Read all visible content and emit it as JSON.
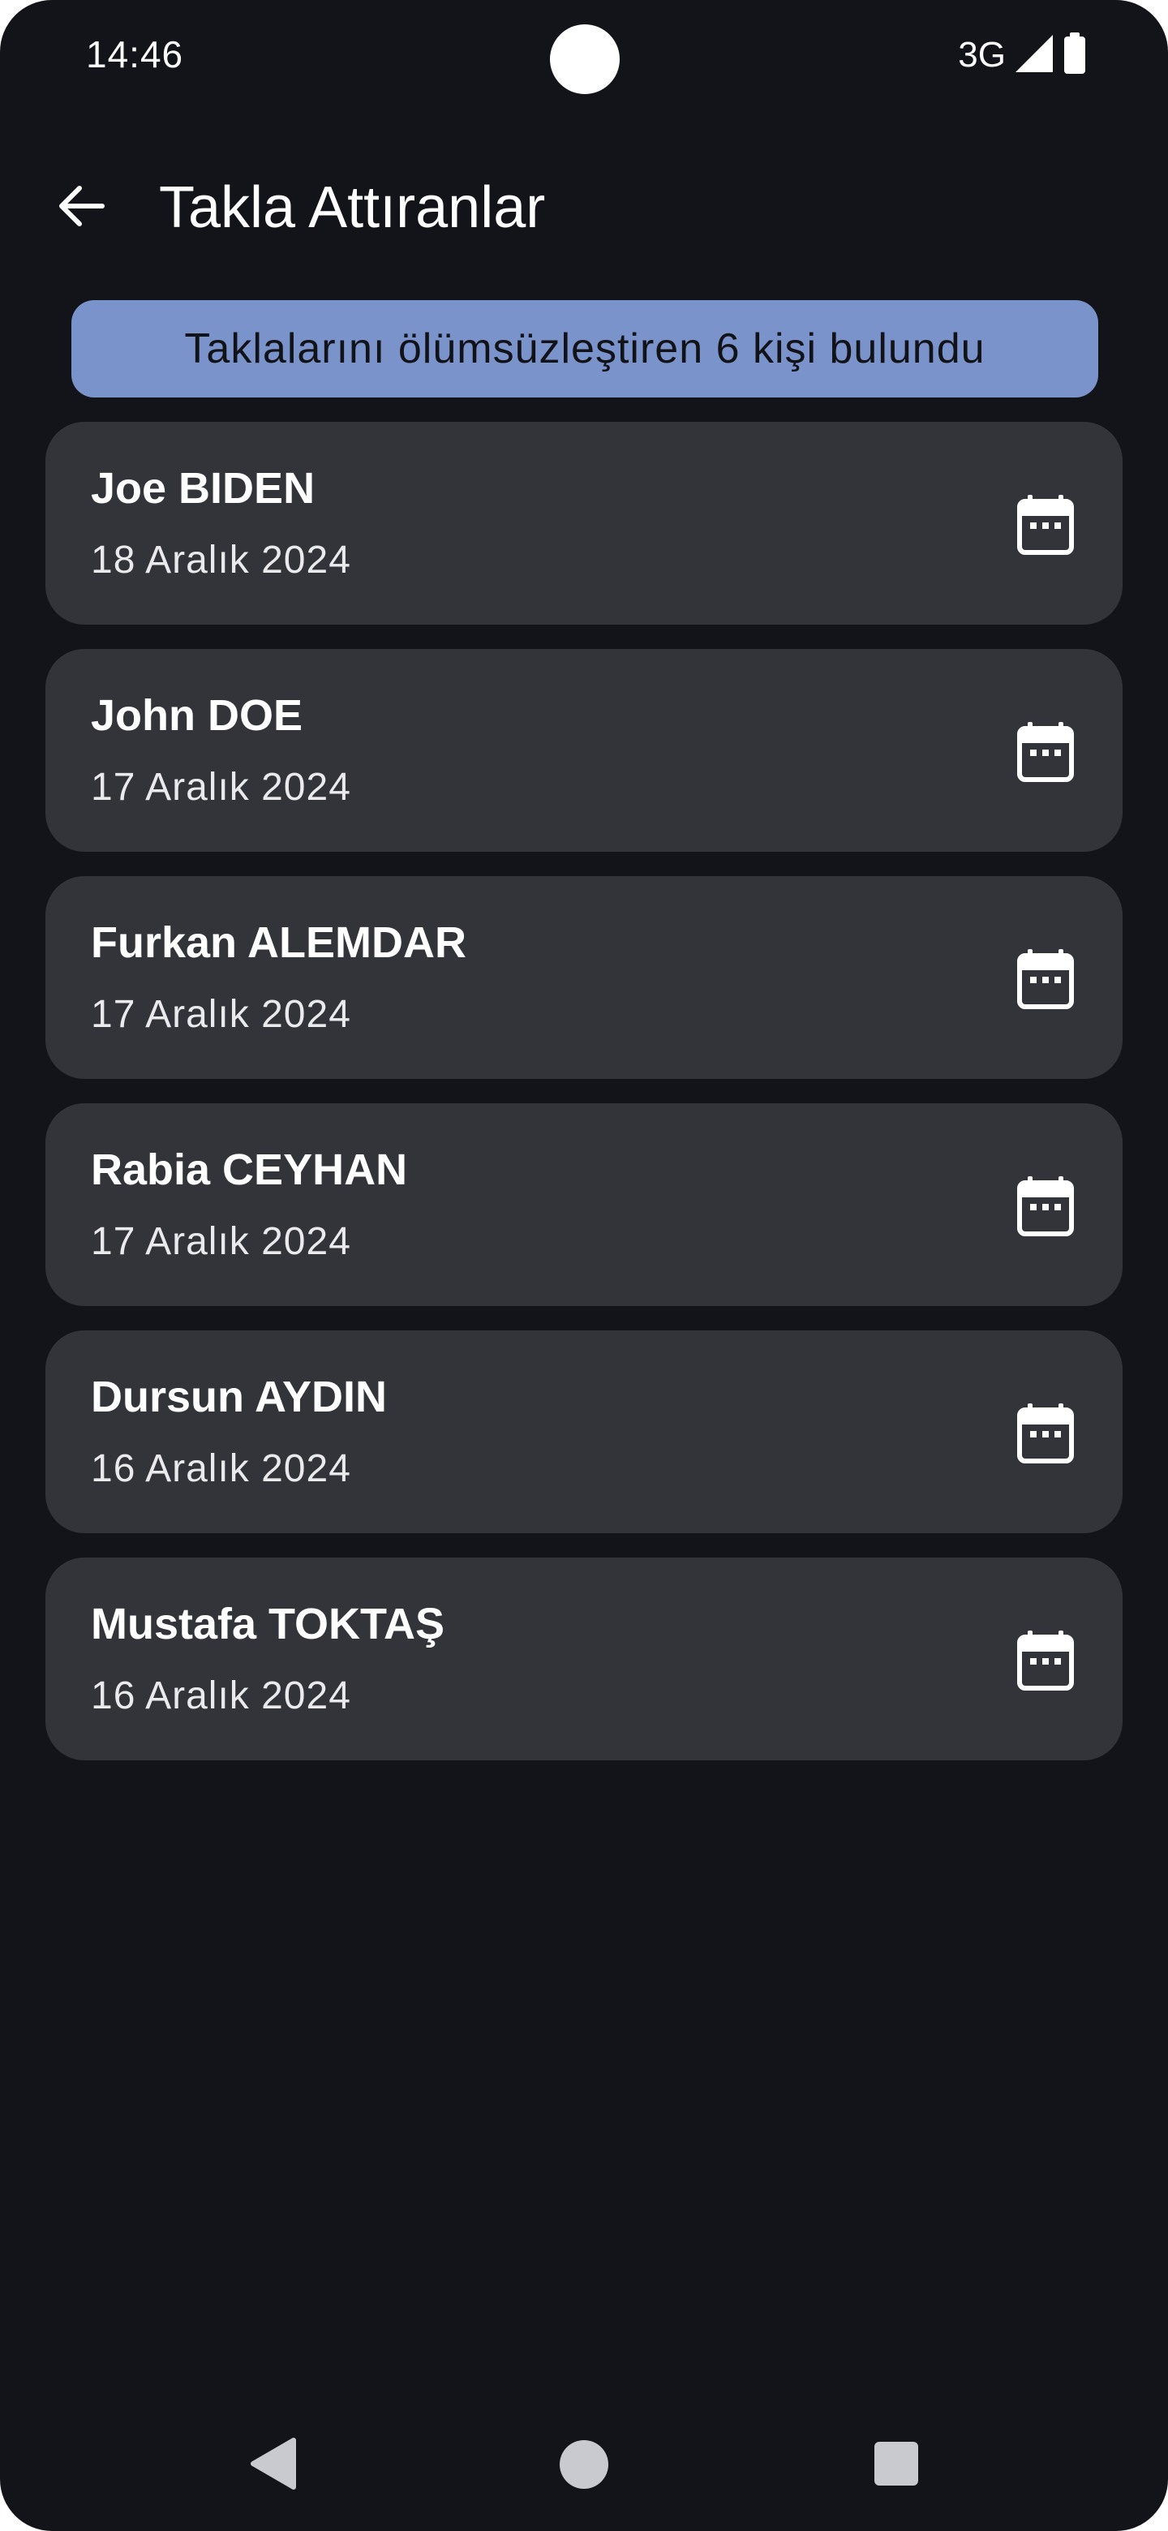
{
  "status_bar": {
    "time": "14:46",
    "network": "3G",
    "icons": [
      "signal-icon",
      "battery-icon"
    ]
  },
  "app_bar": {
    "title": "Takla Attıranlar",
    "back_icon": "arrow-left-icon"
  },
  "banner": {
    "text": "Taklalarını ölümsüzleştiren 6 kişi bulundu",
    "color": "#7a93ca"
  },
  "records": [
    {
      "name": "Joe BIDEN",
      "date": "18 Aralık 2024",
      "icon": "calendar-icon"
    },
    {
      "name": "John DOE",
      "date": "17 Aralık 2024",
      "icon": "calendar-icon"
    },
    {
      "name": "Furkan ALEMDAR",
      "date": "17 Aralık 2024",
      "icon": "calendar-icon"
    },
    {
      "name": "Rabia CEYHAN",
      "date": "17 Aralık 2024",
      "icon": "calendar-icon"
    },
    {
      "name": "Dursun AYDIN",
      "date": "16 Aralık 2024",
      "icon": "calendar-icon"
    },
    {
      "name": "Mustafa TOKTAŞ",
      "date": "16 Aralık 2024",
      "icon": "calendar-icon"
    }
  ],
  "nav_bar": {
    "icons": [
      "nav-back-icon",
      "nav-home-icon",
      "nav-recents-icon"
    ]
  },
  "colors": {
    "background": "#13141a",
    "card": "#33343a",
    "accent": "#7a93ca"
  }
}
